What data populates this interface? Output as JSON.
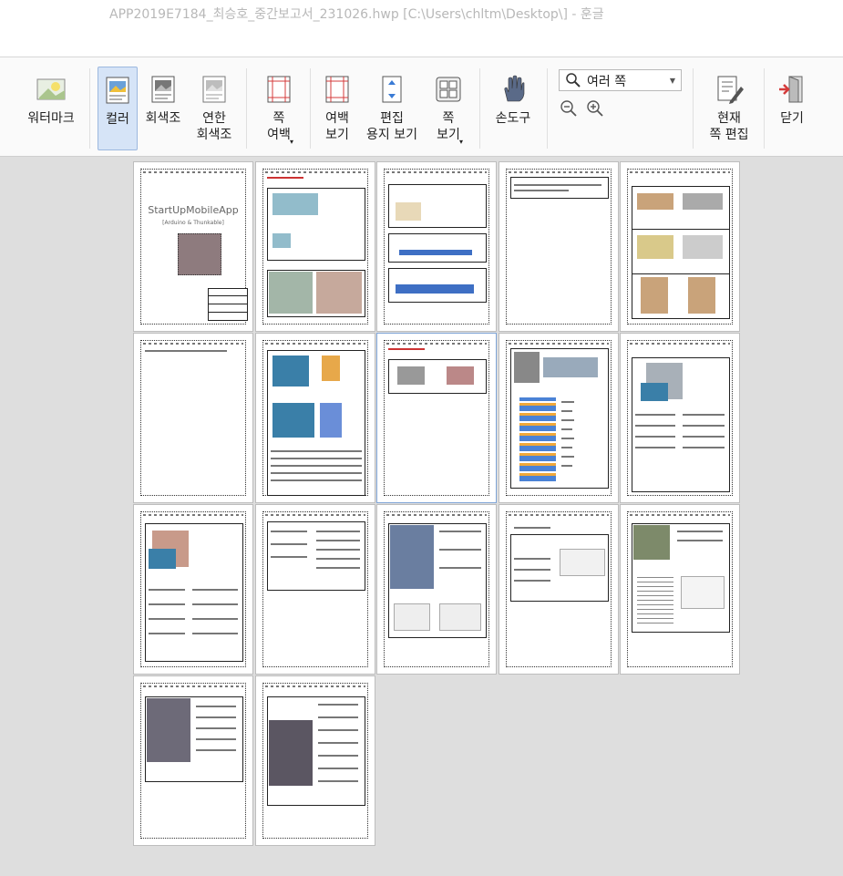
{
  "window": {
    "title": "APP2019E7184_최승호_중간보고서_231026.hwp [C:\\Users\\chltm\\Desktop\\] - 훈글"
  },
  "ribbon": {
    "watermark": "워터마크",
    "color": "컬러",
    "gray": "회색조",
    "light_gray": "연한\n회색조",
    "page_margin": "쪽\n여백",
    "margin_view": "여백\n보기",
    "edit_paper_view": "편집\n용지 보기",
    "page_view": "쪽\n보기",
    "hand_tool": "손도구",
    "zoom_select": "여러 쪽",
    "current_page_edit": "현재\n쪽 편집",
    "close": "닫기"
  },
  "icons": {
    "watermark": "watermark-icon",
    "color": "color-icon",
    "gray": "grayscale-icon",
    "light_gray": "light-grayscale-icon",
    "page_margin": "page-margin-icon",
    "margin_view": "margin-view-icon",
    "edit_paper_view": "edit-paper-icon",
    "page_view": "page-view-icon",
    "hand_tool": "hand-icon",
    "search": "search-icon",
    "zoom_out": "zoom-out-icon",
    "zoom_in": "zoom-in-icon",
    "current_page_edit": "edit-page-icon",
    "close": "exit-icon"
  },
  "preview": {
    "cover_title": "StartUpMobileApp",
    "cover_subtitle": "[Arduino & Thunkable]"
  }
}
